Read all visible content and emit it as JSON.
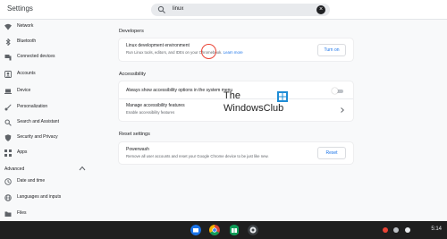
{
  "app": {
    "title": "Settings"
  },
  "search": {
    "value": "linux"
  },
  "sidebar": {
    "items": [
      {
        "label": "Network",
        "icon": "wifi-icon"
      },
      {
        "label": "Bluetooth",
        "icon": "bluetooth-icon"
      },
      {
        "label": "Connected devices",
        "icon": "connected-devices-icon"
      },
      {
        "label": "Accounts",
        "icon": "account-icon"
      },
      {
        "label": "Device",
        "icon": "laptop-icon"
      },
      {
        "label": "Personalization",
        "icon": "brush-icon"
      },
      {
        "label": "Search and Assistant",
        "icon": "search-icon"
      },
      {
        "label": "Security and Privacy",
        "icon": "shield-icon"
      },
      {
        "label": "Apps",
        "icon": "apps-grid-icon"
      }
    ],
    "advanced_label": "Advanced",
    "advanced_items": [
      {
        "label": "Date and time",
        "icon": "clock-icon"
      },
      {
        "label": "Languages and inputs",
        "icon": "globe-icon"
      },
      {
        "label": "Files",
        "icon": "folder-icon"
      }
    ]
  },
  "developers": {
    "title": "Developers",
    "row_title": "Linux development environment",
    "row_sub": "Run Linux tools, editors, and IDEs on your Chromebook.",
    "link": "Learn more",
    "button": "Turn on"
  },
  "accessibility": {
    "title": "Accessibility",
    "toggle_label": "Always show accessibility options in the system menu",
    "toggle_on": false,
    "manage_title": "Manage accessibility features",
    "manage_sub": "Enable accessibility features"
  },
  "reset": {
    "title": "Reset settings",
    "row_title": "Powerwash",
    "row_sub": "Remove all user accounts and reset your Google Chrome device to be just like new.",
    "button": "Reset"
  },
  "watermark": {
    "line1": "The",
    "line2": "WindowsClub"
  },
  "tray": {
    "time": "5:14"
  },
  "colors": {
    "accent": "#1a73e8",
    "highlight": "#ea4335",
    "shelf": "#1f1f1f"
  }
}
